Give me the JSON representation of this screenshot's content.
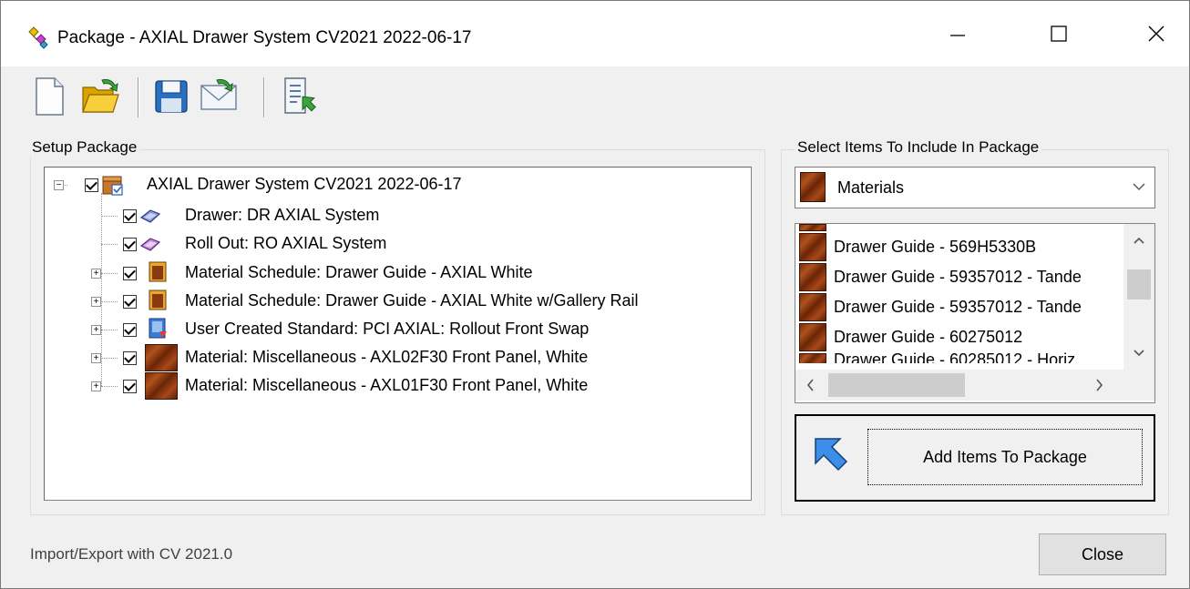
{
  "window": {
    "title": "Package - AXIAL Drawer System CV2021 2022-06-17"
  },
  "toolbar": {
    "buttons": [
      {
        "name": "new-file-icon"
      },
      {
        "name": "open-folder-icon"
      },
      {
        "name": "save-icon"
      },
      {
        "name": "email-icon"
      },
      {
        "name": "export-icon"
      }
    ]
  },
  "setup_package": {
    "label": "Setup Package",
    "tree": [
      {
        "label": "AXIAL Drawer System CV2021 2022-06-17",
        "expander": "−",
        "checked": true,
        "icon": "package-icon"
      },
      {
        "label": "Drawer: DR AXIAL System",
        "expander": "",
        "checked": true,
        "icon": "drawer-icon"
      },
      {
        "label": "Roll Out: RO AXIAL System",
        "expander": "",
        "checked": true,
        "icon": "rollout-icon"
      },
      {
        "label": "Material Schedule: Drawer Guide - AXIAL White",
        "expander": "+",
        "checked": true,
        "icon": "material-schedule-icon"
      },
      {
        "label": "Material Schedule: Drawer Guide - AXIAL White w/Gallery Rail",
        "expander": "+",
        "checked": true,
        "icon": "material-schedule-icon"
      },
      {
        "label": "User Created Standard: PCI AXIAL: Rollout Front Swap",
        "expander": "+",
        "checked": true,
        "icon": "user-standard-icon"
      },
      {
        "label": "Material: Miscellaneous - AXL02F30 Front Panel, White",
        "expander": "+",
        "checked": true,
        "icon": "material-wood-icon"
      },
      {
        "label": "Material: Miscellaneous - AXL01F30 Front Panel, White",
        "expander": "+",
        "checked": true,
        "icon": "material-wood-icon"
      }
    ]
  },
  "select_items": {
    "label": "Select Items To Include In Package",
    "combo_value": "Materials",
    "list": [
      "Drawer Guide - 569H5330B",
      "Drawer Guide - 59357012 - Tande",
      "Drawer Guide - 59357012 - Tande",
      "Drawer Guide - 60275012",
      "Drawer Guide - 60285012 - Horiz"
    ],
    "add_button_label": "Add Items To Package"
  },
  "status_text": "Import/Export with CV 2021.0",
  "close_label": "Close"
}
